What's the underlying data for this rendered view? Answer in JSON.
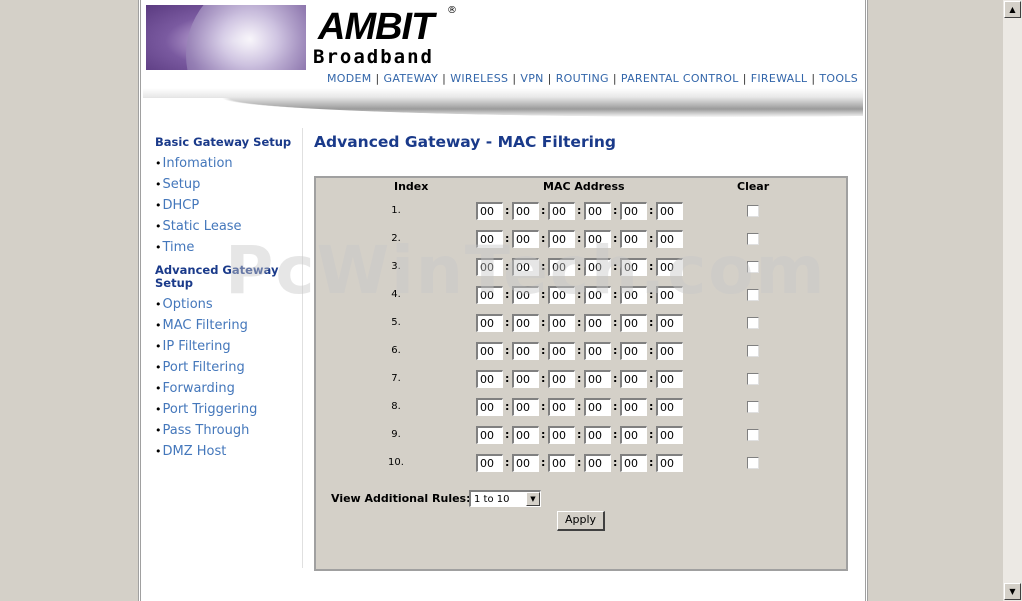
{
  "brand": {
    "logo": "AMBIT",
    "registered": "®",
    "sub": "Broadband"
  },
  "top_nav": [
    "MODEM",
    "GATEWAY",
    "WIRELESS",
    "VPN",
    "ROUTING",
    "PARENTAL CONTROL",
    "FIREWALL",
    "TOOLS"
  ],
  "sidebar": {
    "basic_title": "Basic Gateway Setup",
    "basic_items": [
      "Infomation",
      "Setup",
      "DHCP",
      "Static Lease",
      "Time"
    ],
    "advanced_title": "Advanced Gateway Setup",
    "advanced_items": [
      "Options",
      "MAC Filtering",
      "IP Filtering",
      "Port Filtering",
      "Forwarding",
      "Port Triggering",
      "Pass Through",
      "DMZ Host"
    ],
    "bullet": "•"
  },
  "page_title": "Advanced Gateway - MAC Filtering",
  "table": {
    "headers": {
      "index": "Index",
      "mac": "MAC Address",
      "clear": "Clear"
    },
    "rows": [
      {
        "index": "1.",
        "mac": [
          "00",
          "00",
          "00",
          "00",
          "00",
          "00"
        ],
        "clear": false
      },
      {
        "index": "2.",
        "mac": [
          "00",
          "00",
          "00",
          "00",
          "00",
          "00"
        ],
        "clear": false
      },
      {
        "index": "3.",
        "mac": [
          "00",
          "00",
          "00",
          "00",
          "00",
          "00"
        ],
        "clear": false
      },
      {
        "index": "4.",
        "mac": [
          "00",
          "00",
          "00",
          "00",
          "00",
          "00"
        ],
        "clear": false
      },
      {
        "index": "5.",
        "mac": [
          "00",
          "00",
          "00",
          "00",
          "00",
          "00"
        ],
        "clear": false
      },
      {
        "index": "6.",
        "mac": [
          "00",
          "00",
          "00",
          "00",
          "00",
          "00"
        ],
        "clear": false
      },
      {
        "index": "7.",
        "mac": [
          "00",
          "00",
          "00",
          "00",
          "00",
          "00"
        ],
        "clear": false
      },
      {
        "index": "8.",
        "mac": [
          "00",
          "00",
          "00",
          "00",
          "00",
          "00"
        ],
        "clear": false
      },
      {
        "index": "9.",
        "mac": [
          "00",
          "00",
          "00",
          "00",
          "00",
          "00"
        ],
        "clear": false
      },
      {
        "index": "10.",
        "mac": [
          "00",
          "00",
          "00",
          "00",
          "00",
          "00"
        ],
        "clear": false
      }
    ],
    "separator": ":"
  },
  "view_rules": {
    "label": "View Additional Rules:",
    "selected": "1 to 10"
  },
  "apply_label": "Apply",
  "watermark": "PcWinTech.com",
  "scrollbar": {
    "up_icon": "▲",
    "down_icon": "▼"
  }
}
